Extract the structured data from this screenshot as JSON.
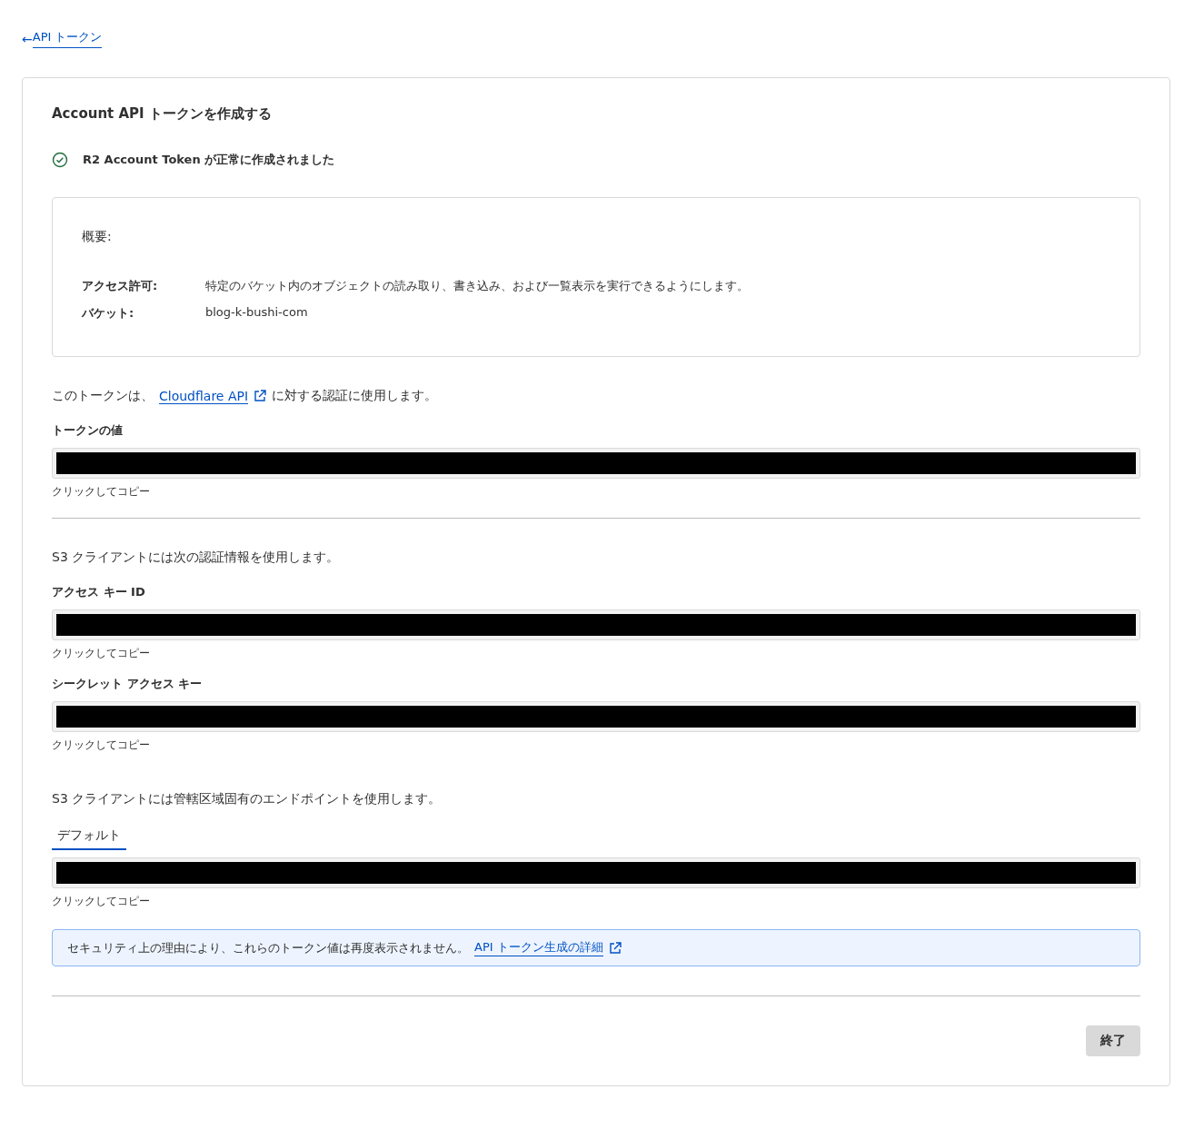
{
  "back_link": {
    "arrow": "←",
    "label": "API トークン"
  },
  "title": "Account API トークンを作成する",
  "success_message": "R2 Account Token が正常に作成されました",
  "summary": {
    "heading": "概要:",
    "rows": [
      {
        "label": "アクセス許可:",
        "value": "特定のバケット内のオブジェクトの読み取り、書き込み、および一覧表示を実行できるようにします。"
      },
      {
        "label": "バケット:",
        "value": "blog-k-bushi-com"
      }
    ]
  },
  "token_section": {
    "intro_before": "このトークンは、",
    "intro_link": "Cloudflare API",
    "intro_after": "に対する認証に使用します。",
    "fields": [
      {
        "label": "トークンの値",
        "redacted": true,
        "hint": "クリックしてコピー"
      }
    ]
  },
  "s3_section": {
    "intro": "S3 クライアントには次の認証情報を使用します。",
    "fields": [
      {
        "label": "アクセス キー ID",
        "redacted": true,
        "hint": "クリックしてコピー"
      },
      {
        "label": "シークレット アクセス キー",
        "redacted": true,
        "hint": "クリックしてコピー"
      }
    ]
  },
  "endpoint_section": {
    "intro": "S3 クライアントには管轄区域固有のエンドポイントを使用します。",
    "tabs": [
      {
        "label": "デフォルト",
        "selected": true
      }
    ],
    "fields": [
      {
        "redacted": true,
        "hint": "クリックしてコピー"
      }
    ]
  },
  "notice": {
    "text": "セキュリティ上の理由により、これらのトークン値は再度表示されません。",
    "link": "API トークン生成の詳細"
  },
  "buttons": [
    {
      "label": "終了"
    }
  ]
}
